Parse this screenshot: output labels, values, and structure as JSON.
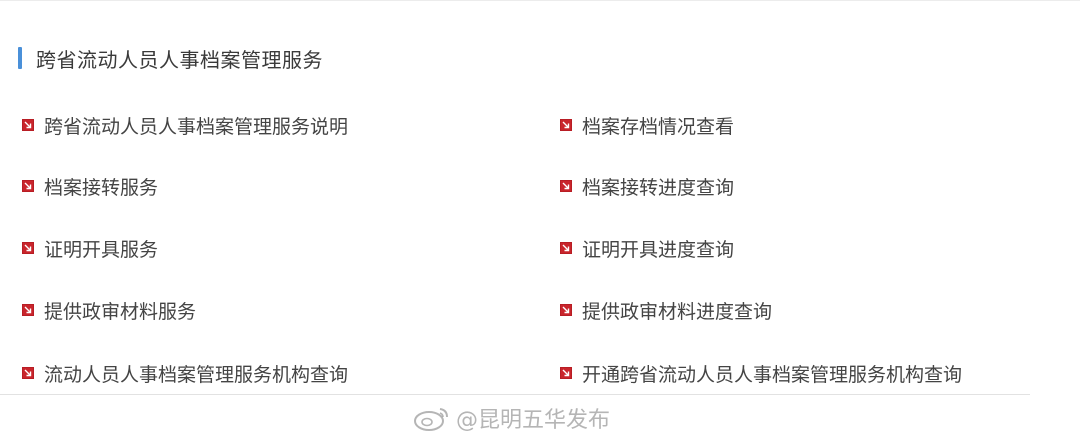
{
  "section": {
    "title": "跨省流动人员人事档案管理服务"
  },
  "colors": {
    "accent": "#4a90d9",
    "bullet": "#c9252c"
  },
  "links": {
    "left": [
      {
        "label": "跨省流动人员人事档案管理服务说明",
        "icon": "arrow-square-icon"
      },
      {
        "label": "档案接转服务",
        "icon": "arrow-square-icon"
      },
      {
        "label": "证明开具服务",
        "icon": "arrow-square-icon"
      },
      {
        "label": "提供政审材料服务",
        "icon": "arrow-square-icon"
      },
      {
        "label": "流动人员人事档案管理服务机构查询",
        "icon": "arrow-square-icon"
      }
    ],
    "right": [
      {
        "label": "档案存档情况查看",
        "icon": "arrow-square-icon"
      },
      {
        "label": "档案接转进度查询",
        "icon": "arrow-square-icon"
      },
      {
        "label": "证明开具进度查询",
        "icon": "arrow-square-icon"
      },
      {
        "label": "提供政审材料进度查询",
        "icon": "arrow-square-icon"
      },
      {
        "label": "开通跨省流动人员人事档案管理服务机构查询",
        "icon": "arrow-square-icon"
      }
    ]
  },
  "watermark": {
    "text": "@昆明五华发布",
    "icon": "weibo-icon"
  }
}
